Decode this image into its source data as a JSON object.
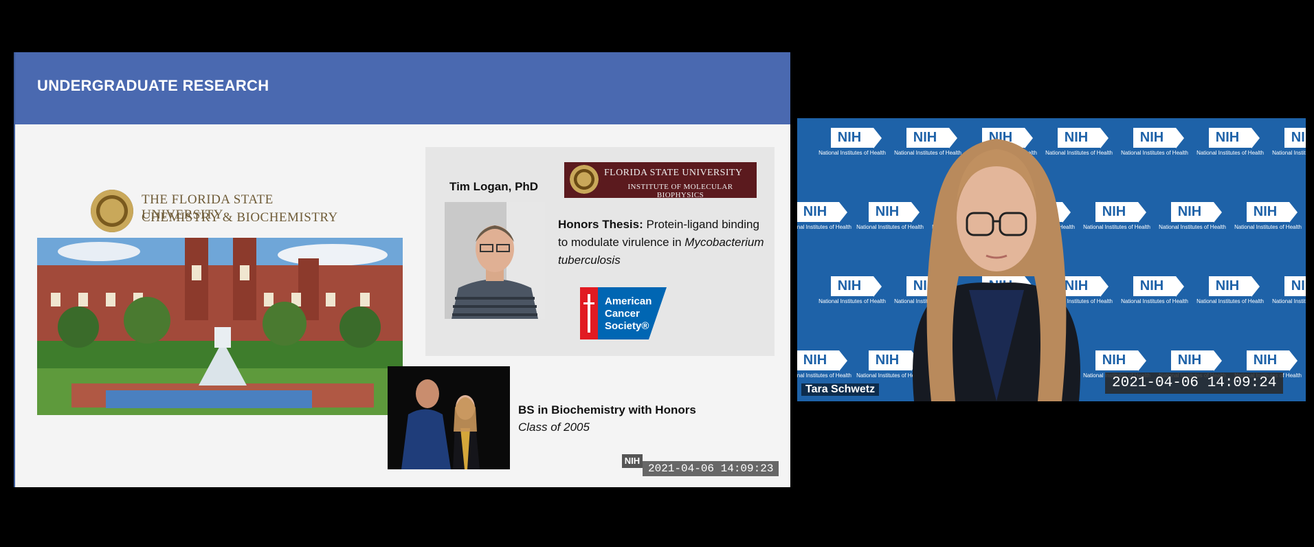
{
  "slide": {
    "title": "UNDERGRADUATE RESEARCH",
    "fsu_logo": {
      "line1": "THE FLORIDA STATE UNIVERSITY",
      "line2": "CHEMISTRY & BIOCHEMISTRY"
    },
    "mentor": {
      "name": "Tim Logan, PhD",
      "institute_logo_line1": "FLORIDA STATE UNIVERSITY",
      "institute_logo_line2": "INSTITUTE OF MOLECULAR BIOPHYSICS",
      "thesis_label": "Honors Thesis:",
      "thesis_text": "Protein-ligand binding to modulate virulence in",
      "thesis_organism": "Mycobacterium tuberculosis",
      "sponsor_logo_line1": "American",
      "sponsor_logo_line2": "Cancer",
      "sponsor_logo_line3": "Society®"
    },
    "degree": {
      "title": "BS in Biochemistry with Honors",
      "class": "Class of 2005"
    },
    "footer_badge": "NIH",
    "timestamp": "2021-04-06  14:09:23"
  },
  "video": {
    "backdrop_badge": "NIH",
    "backdrop_subtitle": "National Institutes of Health",
    "speaker_name": "Tara Schwetz",
    "timestamp": "2021-04-06  14:09:24"
  },
  "colors": {
    "slide_header": "#4a69b0",
    "video_backdrop": "#1e62a8",
    "institute_logo": "#5b1a1e",
    "acs_red": "#e11b22",
    "acs_blue": "#0066b3"
  }
}
